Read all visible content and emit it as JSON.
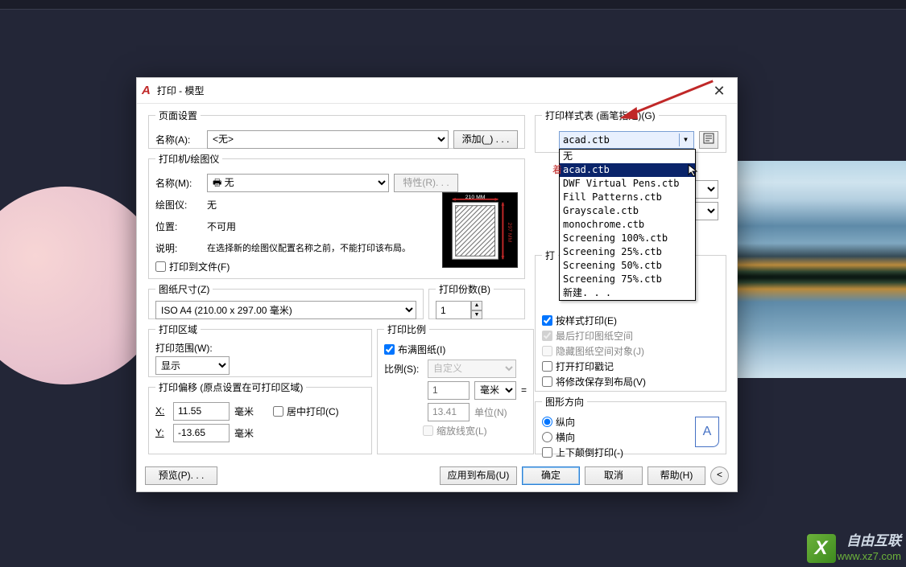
{
  "titlebar": {
    "title": "打印 - 模型"
  },
  "page_setup": {
    "legend": "页面设置",
    "name_label": "名称(A):",
    "name_value": "<无>",
    "add_btn": "添加(_) . . ."
  },
  "printer": {
    "legend": "打印机/绘图仪",
    "name_label": "名称(M):",
    "name_value": "无",
    "props_btn": "特性(R). . .",
    "plotter_label": "绘图仪:",
    "plotter_value": "无",
    "where_label": "位置:",
    "where_value": "不可用",
    "desc_label": "说明:",
    "desc_value": "在选择新的绘图仪配置名称之前，不能打印该布局。",
    "tofile_label": "打印到文件(F)",
    "preview_dim": "210 MM"
  },
  "paper": {
    "legend": "图纸尺寸(Z)",
    "value": "ISO A4 (210.00 x 297.00 毫米)"
  },
  "copies": {
    "legend": "打印份数(B)",
    "value": "1"
  },
  "area": {
    "legend": "打印区域",
    "range_label": "打印范围(W):",
    "range_value": "显示"
  },
  "scale": {
    "legend": "打印比例",
    "fit_label": "布满图纸(I)",
    "ratio_label": "比例(S):",
    "ratio_value": "自定义",
    "num_value": "1",
    "unit_value": "毫米",
    "den_value": "13.41",
    "den_unit_label": "单位(N)",
    "lw_label": "缩放线宽(L)"
  },
  "offset": {
    "legend": "打印偏移 (原点设置在可打印区域)",
    "x_label": "X:",
    "x_value": "11.55",
    "unit": "毫米",
    "center_label": "居中打印(C)",
    "y_label": "Y:",
    "y_value": "-13.65"
  },
  "style": {
    "legend": "打印样式表 (画笔指定)(G)",
    "combo_value": "acad.ctb",
    "dropdown": {
      "items": [
        "无",
        "acad.ctb",
        "DWF Virtual Pens.ctb",
        "Fill Patterns.ctb",
        "Grayscale.ctb",
        "monochrome.ctb",
        "Screening 100%.ctb",
        "Screening 25%.ctb",
        "Screening 50%.ctb",
        "Screening 75%.ctb",
        "新建. . ."
      ],
      "selected_index": 1
    },
    "red_tag": "着"
  },
  "options": {
    "legend": "打",
    "items": {
      "bystyle": "按样式打印(E)",
      "lastpaper": "最后打印图纸空间",
      "hidepaper": "隐藏图纸空间对象(J)",
      "stamp": "打开打印戳记",
      "savechanges": "将修改保存到布局(V)"
    }
  },
  "orient": {
    "legend": "图形方向",
    "portrait": "纵向",
    "landscape": "横向",
    "upside": "上下颠倒打印(-)"
  },
  "bottom": {
    "preview": "预览(P). . .",
    "apply": "应用到布局(U)",
    "ok": "确定",
    "cancel": "取消",
    "help": "帮助(H)"
  },
  "watermark": {
    "name": "自由互联",
    "url": "www.xz7.com"
  }
}
